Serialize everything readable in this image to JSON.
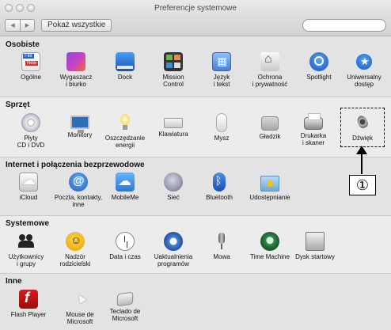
{
  "window": {
    "title": "Preferencje systemowe"
  },
  "toolbar": {
    "back": "◀",
    "forward": "▶",
    "show_all": "Pokaż wszystkie",
    "search_placeholder": ""
  },
  "sections": {
    "osobiste": {
      "title": "Osobiste",
      "items": [
        {
          "label": "Ogólne",
          "icon": "general-icon"
        },
        {
          "label": "Wygaszacz\ni biurko",
          "icon": "desktop-screensaver-icon"
        },
        {
          "label": "Dock",
          "icon": "dock-icon"
        },
        {
          "label": "Mission\nControl",
          "icon": "mission-control-icon"
        },
        {
          "label": "Język\ni tekst",
          "icon": "language-text-icon"
        },
        {
          "label": "Ochrona\ni prywatność",
          "icon": "security-privacy-icon"
        },
        {
          "label": "Spotlight",
          "icon": "spotlight-icon"
        },
        {
          "label": "Uniwersalny\ndostęp",
          "icon": "universal-access-icon"
        }
      ]
    },
    "sprzet": {
      "title": "Sprzęt",
      "items": [
        {
          "label": "Płyty\nCD i DVD",
          "icon": "cd-dvd-icon"
        },
        {
          "label": "Monitory",
          "icon": "displays-icon"
        },
        {
          "label": "Oszczędzanie\nenergii",
          "icon": "energy-saver-icon"
        },
        {
          "label": "Klawiatura",
          "icon": "keyboard-icon"
        },
        {
          "label": "Mysz",
          "icon": "mouse-icon"
        },
        {
          "label": "Gładzik",
          "icon": "trackpad-icon"
        },
        {
          "label": "Drukarka\ni skaner",
          "icon": "printer-scanner-icon"
        },
        {
          "label": "Dźwięk",
          "icon": "sound-icon"
        }
      ]
    },
    "internet": {
      "title": "Internet i połączenia bezprzewodowe",
      "items": [
        {
          "label": "iCloud",
          "icon": "icloud-icon"
        },
        {
          "label": "Poczta, kontakty,\ninne",
          "icon": "mail-contacts-icon"
        },
        {
          "label": "MobileMe",
          "icon": "mobileme-icon"
        },
        {
          "label": "Sieć",
          "icon": "network-icon"
        },
        {
          "label": "Bluetooth",
          "icon": "bluetooth-icon"
        },
        {
          "label": "Udostępnianie",
          "icon": "sharing-icon"
        }
      ]
    },
    "systemowe": {
      "title": "Systemowe",
      "items": [
        {
          "label": "Użytkownicy\ni grupy",
          "icon": "users-groups-icon"
        },
        {
          "label": "Nadzór\nrodzicielski",
          "icon": "parental-controls-icon"
        },
        {
          "label": "Data i czas",
          "icon": "date-time-icon"
        },
        {
          "label": "Uaktualnienia\nprogramów",
          "icon": "software-update-icon"
        },
        {
          "label": "Mowa",
          "icon": "speech-icon"
        },
        {
          "label": "Time Machine",
          "icon": "time-machine-icon"
        },
        {
          "label": "Dysk startowy",
          "icon": "startup-disk-icon"
        }
      ]
    },
    "inne": {
      "title": "Inne",
      "items": [
        {
          "label": "Flash Player",
          "icon": "flash-player-icon"
        },
        {
          "label": "Mouse de\nMicrosoft",
          "icon": "microsoft-mouse-icon"
        },
        {
          "label": "Teclado de\nMicrosoft",
          "icon": "microsoft-keyboard-icon"
        }
      ]
    }
  },
  "annotation": {
    "callout_label": "①"
  }
}
